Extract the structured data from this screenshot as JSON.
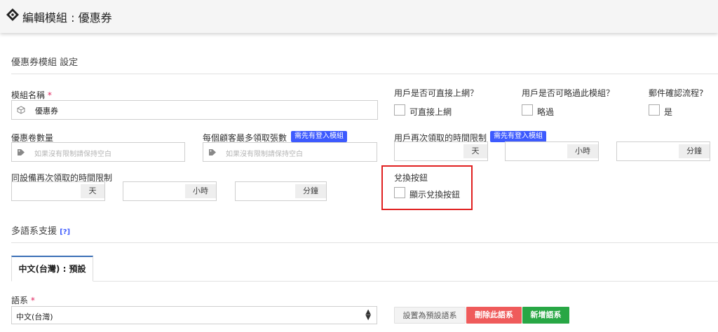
{
  "header": {
    "title": "編輯模組 : 優惠券"
  },
  "section": {
    "title": "優惠券模組 設定"
  },
  "module_name": {
    "label": "模組名稱",
    "required": "*",
    "value": "優惠券"
  },
  "direct_online": {
    "label": "用戶是否可直接上網？",
    "checkbox_label": "可直接上網"
  },
  "skip_module": {
    "label": "用戶是否可略過此模組？",
    "checkbox_label": "略過"
  },
  "email_confirm": {
    "label": "郵件確認流程?",
    "checkbox_label": "是"
  },
  "coupon_count": {
    "label": "優惠卷數量",
    "placeholder": "如果沒有限制請保持空白"
  },
  "max_per_customer": {
    "label": "每個顧客最多領取張數",
    "badge": "需先有登入模組",
    "placeholder": "如果沒有限制請保持空白"
  },
  "user_retake_limit": {
    "label": "用戶再次領取的時間限制",
    "badge": "需先有登入模組",
    "unit_day": "天",
    "unit_hour": "小時",
    "unit_min": "分鐘"
  },
  "device_retake_limit": {
    "label": "同設備再次領取的時間限制",
    "unit_day": "天",
    "unit_hour": "小時",
    "unit_min": "分鐘"
  },
  "redeem_button": {
    "label": "兌換按鈕",
    "checkbox_label": "顯示兌換按鈕"
  },
  "multilang": {
    "title": "多語系支援",
    "help": "[?]"
  },
  "tabs": [
    {
      "label": "中文(台灣) : 預設"
    }
  ],
  "language": {
    "label": "語系",
    "required": "*",
    "value": "中文(台灣)"
  },
  "buttons": {
    "set_default": "設置為預設語系",
    "delete": "刪除此語系",
    "add": "新增語系"
  },
  "colors": {
    "badge": "#3d5afe",
    "highlight": "#e02020",
    "danger": "#ef5b5b",
    "success": "#28a745",
    "tab_accent": "#3b6fb6"
  }
}
